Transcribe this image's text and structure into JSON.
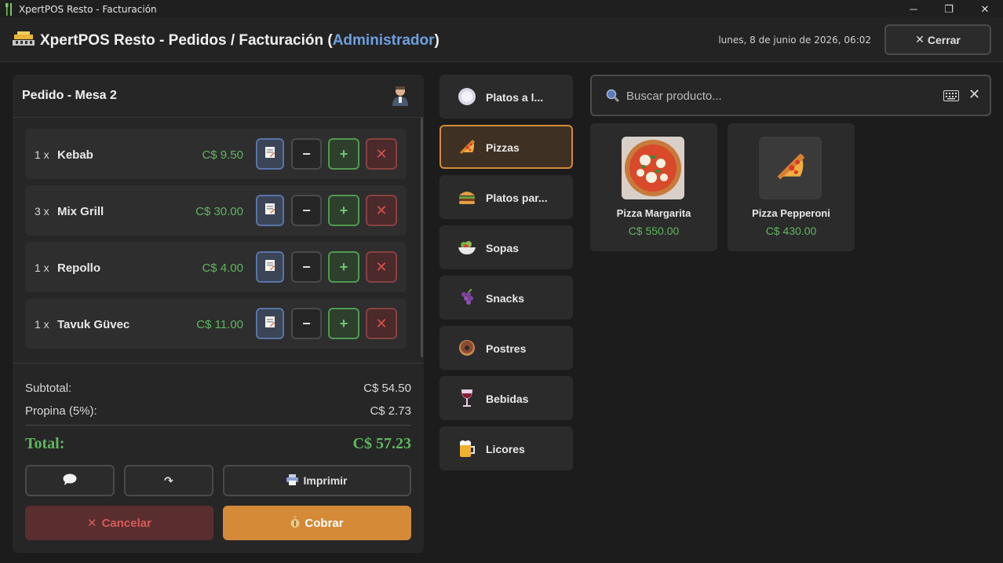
{
  "window": {
    "title": "XpertPOS Resto - Facturación",
    "minimize": "─",
    "maximize": "❐",
    "close": "✕"
  },
  "header": {
    "title_prefix": "XpertPOS Resto - Pedidos / Facturación (",
    "role": "Administrador",
    "title_suffix": ")",
    "date": "lunes, 8 de junio de 2026, 06:02",
    "close_icon": "✕",
    "close_label": "Cerrar"
  },
  "order": {
    "title": "Pedido - Mesa 2",
    "items": [
      {
        "qty": "1 x",
        "name": "Kebab",
        "price": "C$ 9.50"
      },
      {
        "qty": "3 x",
        "name": "Mix Grill",
        "price": "C$ 30.00"
      },
      {
        "qty": "1 x",
        "name": "Repollo",
        "price": "C$ 4.00"
      },
      {
        "qty": "1 x",
        "name": "Tavuk Güvec",
        "price": "C$ 11.00"
      }
    ],
    "item_buttons": {
      "minus": "−",
      "plus": "+",
      "delete": "✕"
    },
    "subtotal_label": "Subtotal:",
    "subtotal_value": "C$ 54.50",
    "tip_label": "Propina (5%):",
    "tip_value": "C$ 2.73",
    "total_label": "Total:",
    "total_value": "C$ 57.23",
    "print_label": "Imprimir",
    "transfer_icon": "↷",
    "cancel_icon": "✕",
    "cancel_label": "Cancelar",
    "pay_label": "Cobrar"
  },
  "categories": [
    {
      "label": "Platos a l...",
      "icon": "plate-icon",
      "active": false
    },
    {
      "label": "Pizzas",
      "icon": "pizza-icon",
      "active": true
    },
    {
      "label": "Platos par...",
      "icon": "burger-icon",
      "active": false
    },
    {
      "label": "Sopas",
      "icon": "salad-icon",
      "active": false
    },
    {
      "label": "Snacks",
      "icon": "grapes-icon",
      "active": false
    },
    {
      "label": "Postres",
      "icon": "donut-icon",
      "active": false
    },
    {
      "label": "Bebidas",
      "icon": "wine-icon",
      "active": false
    },
    {
      "label": "Licores",
      "icon": "beer-icon",
      "active": false
    }
  ],
  "search": {
    "placeholder": "Buscar producto...",
    "clear": "✕"
  },
  "products": [
    {
      "name": "Pizza Margarita",
      "price": "C$ 550.00"
    },
    {
      "name": "Pizza Pepperoni",
      "price": "C$ 430.00"
    }
  ],
  "colors": {
    "accent": "#d48a36",
    "price_green": "#5fb65f",
    "role_blue": "#6ea0e0",
    "danger": "#d85050"
  }
}
